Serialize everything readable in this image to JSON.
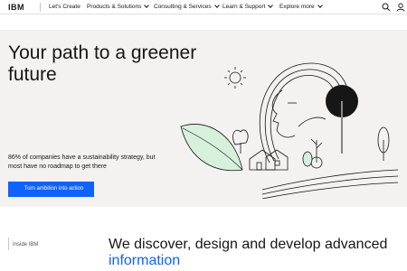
{
  "header": {
    "logo": "IBM",
    "nav_items": [
      {
        "label": "Let's Create",
        "has_dropdown": false
      },
      {
        "label": "Products & Solutions",
        "has_dropdown": true
      },
      {
        "label": "Consulting & Services",
        "has_dropdown": true
      },
      {
        "label": "Learn & Support",
        "has_dropdown": true
      },
      {
        "label": "Explore more",
        "has_dropdown": true
      }
    ],
    "icons": [
      "search-icon",
      "user-icon"
    ]
  },
  "hero": {
    "title": "Your path to a greener future",
    "description": "86% of companies have a sustainability strategy, but most have no roadmap to get there",
    "cta_label": "Turn ambition into action",
    "background": "#f4f2f0"
  },
  "section": {
    "label": "Inside IBM",
    "heading_main": "We discover, design and develop advanced ",
    "heading_accent": "information"
  },
  "colors": {
    "accent": "#0f62fe",
    "text": "#161616",
    "leaf_green": "#d6f0dc"
  }
}
